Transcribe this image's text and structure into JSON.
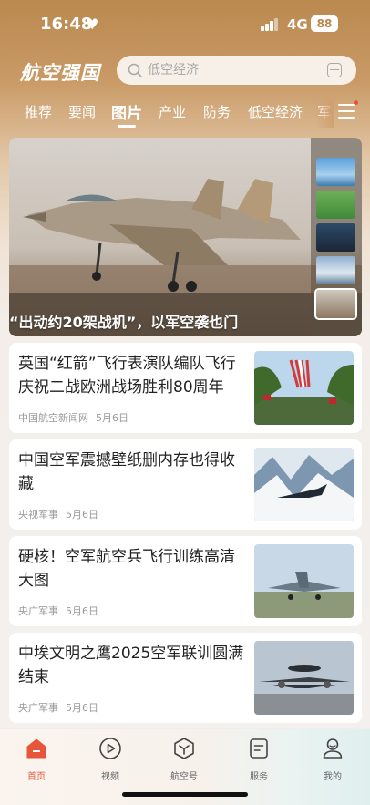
{
  "status_bar": {
    "time": "16:48",
    "network": "4G",
    "battery": "88"
  },
  "header": {
    "logo_text": "航空强国",
    "search_placeholder": "低空经济"
  },
  "tabs": [
    {
      "label": "推荐"
    },
    {
      "label": "要闻"
    },
    {
      "label": "图片"
    },
    {
      "label": "产业"
    },
    {
      "label": "防务"
    },
    {
      "label": "低空经济"
    },
    {
      "label": "军"
    }
  ],
  "active_tab": "图片",
  "hero": {
    "caption": "“出动约20架战机”，以军空袭也门"
  },
  "news": [
    {
      "title": "英国“红箭”飞行表演队编队飞行庆祝二战欧洲战场胜利80周年",
      "source": "中国航空新闻网",
      "date": "5月6日"
    },
    {
      "title": "中国空军震撼壁纸删内存也得收藏",
      "source": "央视军事",
      "date": "5月6日"
    },
    {
      "title": "硬核！空军航空兵飞行训练高清大图",
      "source": "央广军事",
      "date": "5月6日"
    },
    {
      "title": "中埃文明之鹰2025空军联训圆满结束",
      "source": "央广军事",
      "date": "5月6日"
    }
  ],
  "bottom_nav": [
    {
      "label": "首页",
      "icon": "home-icon"
    },
    {
      "label": "视频",
      "icon": "play-icon"
    },
    {
      "label": "航空号",
      "icon": "hexagon-icon"
    },
    {
      "label": "服务",
      "icon": "document-icon"
    },
    {
      "label": "我的",
      "icon": "user-icon"
    }
  ],
  "colors": {
    "accent": "#e55a3c",
    "header_bg": "#b9894f"
  }
}
